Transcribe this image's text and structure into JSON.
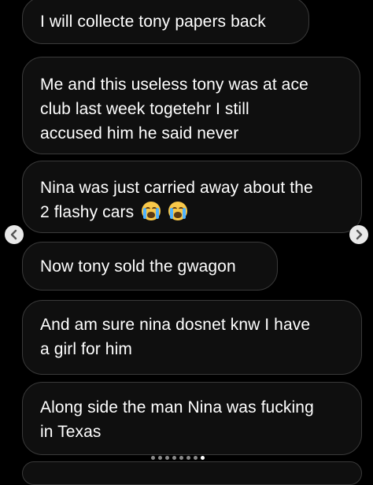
{
  "messages": [
    {
      "lines": [
        "I will collecte tony papers back"
      ]
    },
    {
      "lines": [
        "Me and this useless tony was at ace",
        "club last week togetehr I still",
        "accused him he said never"
      ]
    },
    {
      "lines": [
        "Nina was just carried away about the",
        "2 flashy cars"
      ],
      "emoji": [
        "loudly-crying-face-icon",
        "loudly-crying-face-icon"
      ]
    },
    {
      "lines": [
        "Now tony sold the gwagon"
      ]
    },
    {
      "lines": [
        "And am sure nina dosnet knw I have",
        "a girl for him"
      ]
    },
    {
      "lines": [
        "Along side the man Nina was fucking",
        "in Texas"
      ]
    }
  ],
  "carousel": {
    "prev_icon": "chevron-left-icon",
    "next_icon": "chevron-right-icon",
    "dot_count": 8,
    "active_dot": 7
  },
  "colors": {
    "background": "#000000",
    "bubble_fill": "#0f0f0f",
    "bubble_border": "#3a3a3a",
    "text": "#ffffff"
  }
}
